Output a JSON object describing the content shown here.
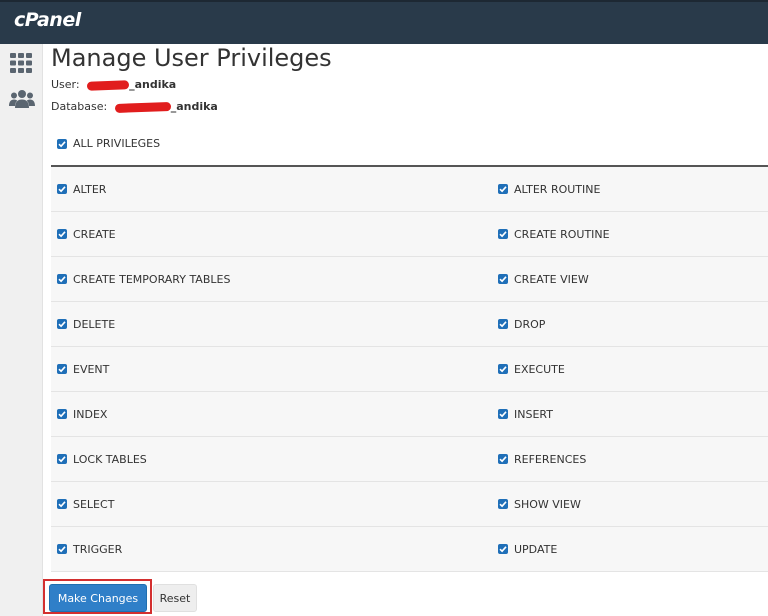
{
  "header": {
    "logo_text": "cPanel",
    "background": "#293a4a"
  },
  "sidebar": {
    "items": [
      {
        "icon": "apps-grid-icon"
      },
      {
        "icon": "users-icon"
      }
    ]
  },
  "page": {
    "title": "Manage User Privileges",
    "user_label": "User:",
    "user_value_suffix": "_andika",
    "database_label": "Database:",
    "database_value_suffix": "_andika"
  },
  "privileges": {
    "all_label": "ALL PRIVILEGES",
    "all_checked": true,
    "rows": [
      {
        "left": "ALTER",
        "right": "ALTER ROUTINE"
      },
      {
        "left": "CREATE",
        "right": "CREATE ROUTINE"
      },
      {
        "left": "CREATE TEMPORARY TABLES",
        "right": "CREATE VIEW"
      },
      {
        "left": "DELETE",
        "right": "DROP"
      },
      {
        "left": "EVENT",
        "right": "EXECUTE"
      },
      {
        "left": "INDEX",
        "right": "INSERT"
      },
      {
        "left": "LOCK TABLES",
        "right": "REFERENCES"
      },
      {
        "left": "SELECT",
        "right": "SHOW VIEW"
      },
      {
        "left": "TRIGGER",
        "right": "UPDATE"
      }
    ],
    "all_items_checked": true
  },
  "actions": {
    "make_changes_label": "Make Changes",
    "reset_label": "Reset",
    "primary_color": "#2f7fc8",
    "highlight_color": "#d32f2f"
  }
}
